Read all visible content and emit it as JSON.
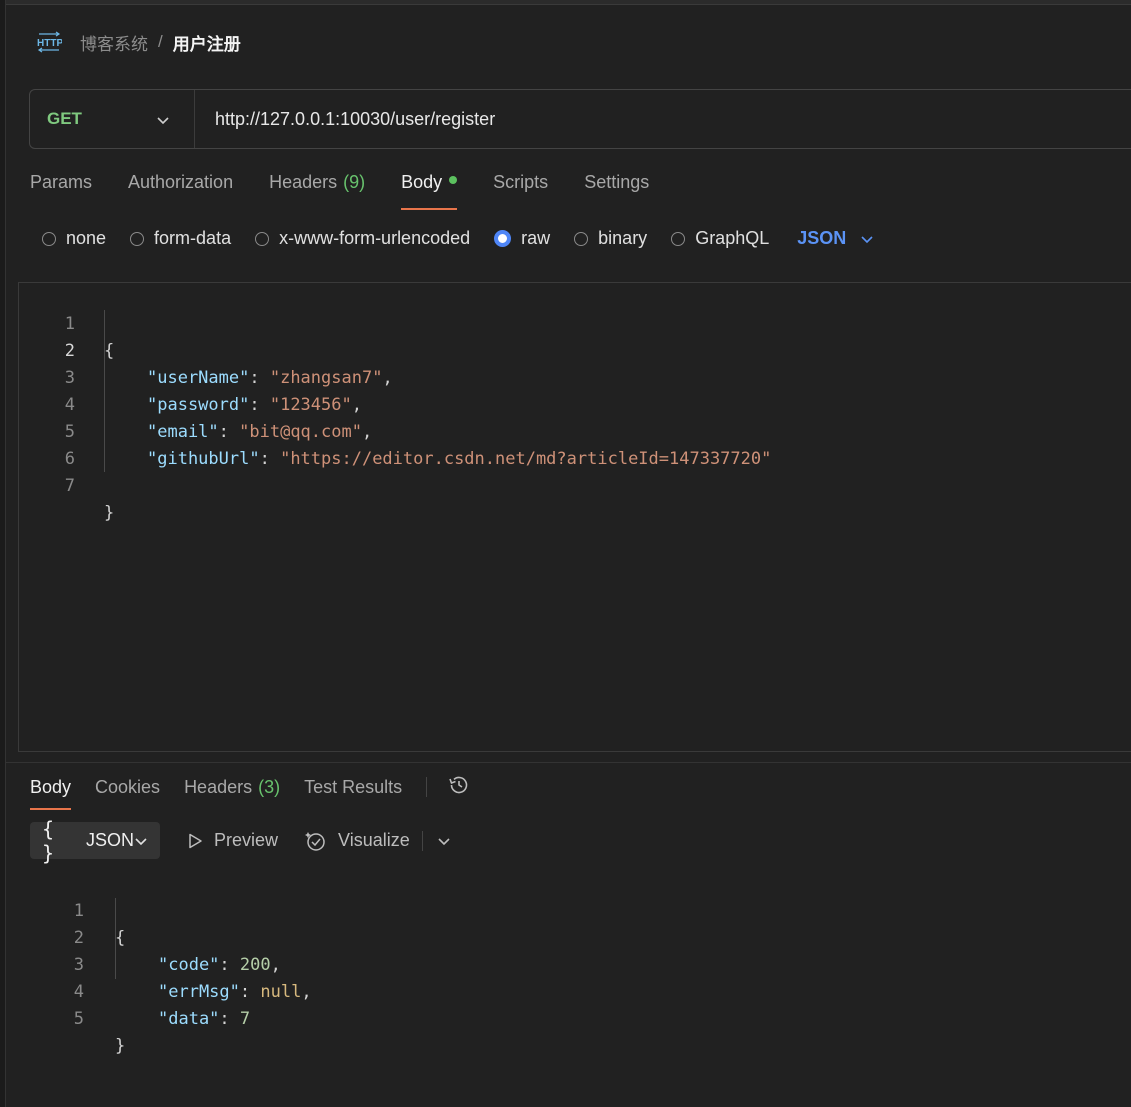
{
  "breadcrumb": {
    "icon": "http-icon",
    "parent": "博客系统",
    "separator": "/",
    "current": "用户注册"
  },
  "request": {
    "method": "GET",
    "url": "http://127.0.0.1:10030/user/register"
  },
  "request_tabs": {
    "params": "Params",
    "authorization": "Authorization",
    "headers": "Headers",
    "headers_count": "(9)",
    "body": "Body",
    "scripts": "Scripts",
    "settings": "Settings",
    "active": "Body"
  },
  "body_types": {
    "none": "none",
    "form_data": "form-data",
    "urlencoded": "x-www-form-urlencoded",
    "raw": "raw",
    "binary": "binary",
    "graphql": "GraphQL",
    "selected": "raw",
    "format": "JSON"
  },
  "request_body": {
    "line_numbers": [
      "1",
      "2",
      "3",
      "4",
      "5",
      "6",
      "7"
    ],
    "fields": [
      {
        "key": "\"userName\"",
        "value": "\"zhangsan7\""
      },
      {
        "key": "\"password\"",
        "value": "\"123456\""
      },
      {
        "key": "\"email\"",
        "value": "\"bit@qq.com\""
      },
      {
        "key": "\"githubUrl\"",
        "value": "\"https://editor.csdn.net/md?articleId=147337720\""
      }
    ],
    "open_brace": "{",
    "close_brace": "}"
  },
  "response_tabs": {
    "body": "Body",
    "cookies": "Cookies",
    "headers": "Headers",
    "headers_count": "(3)",
    "test_results": "Test Results",
    "active": "Body"
  },
  "response_tools": {
    "format": "JSON",
    "format_icon": "{ }",
    "preview": "Preview",
    "visualize": "Visualize"
  },
  "response_body": {
    "line_numbers": [
      "1",
      "2",
      "3",
      "4",
      "5"
    ],
    "fields": [
      {
        "key": "\"code\"",
        "value": "200",
        "type": "number"
      },
      {
        "key": "\"errMsg\"",
        "value": "null",
        "type": "null"
      },
      {
        "key": "\"data\"",
        "value": "7",
        "type": "number"
      }
    ],
    "open_brace": "{",
    "close_brace": "}"
  },
  "colors": {
    "background": "#212121",
    "accent_tab": "#e8754b",
    "method_get": "#7fc97f",
    "json_link": "#5b93f5",
    "key": "#9cdcfe",
    "string": "#ce9178",
    "number": "#b5cea8"
  }
}
